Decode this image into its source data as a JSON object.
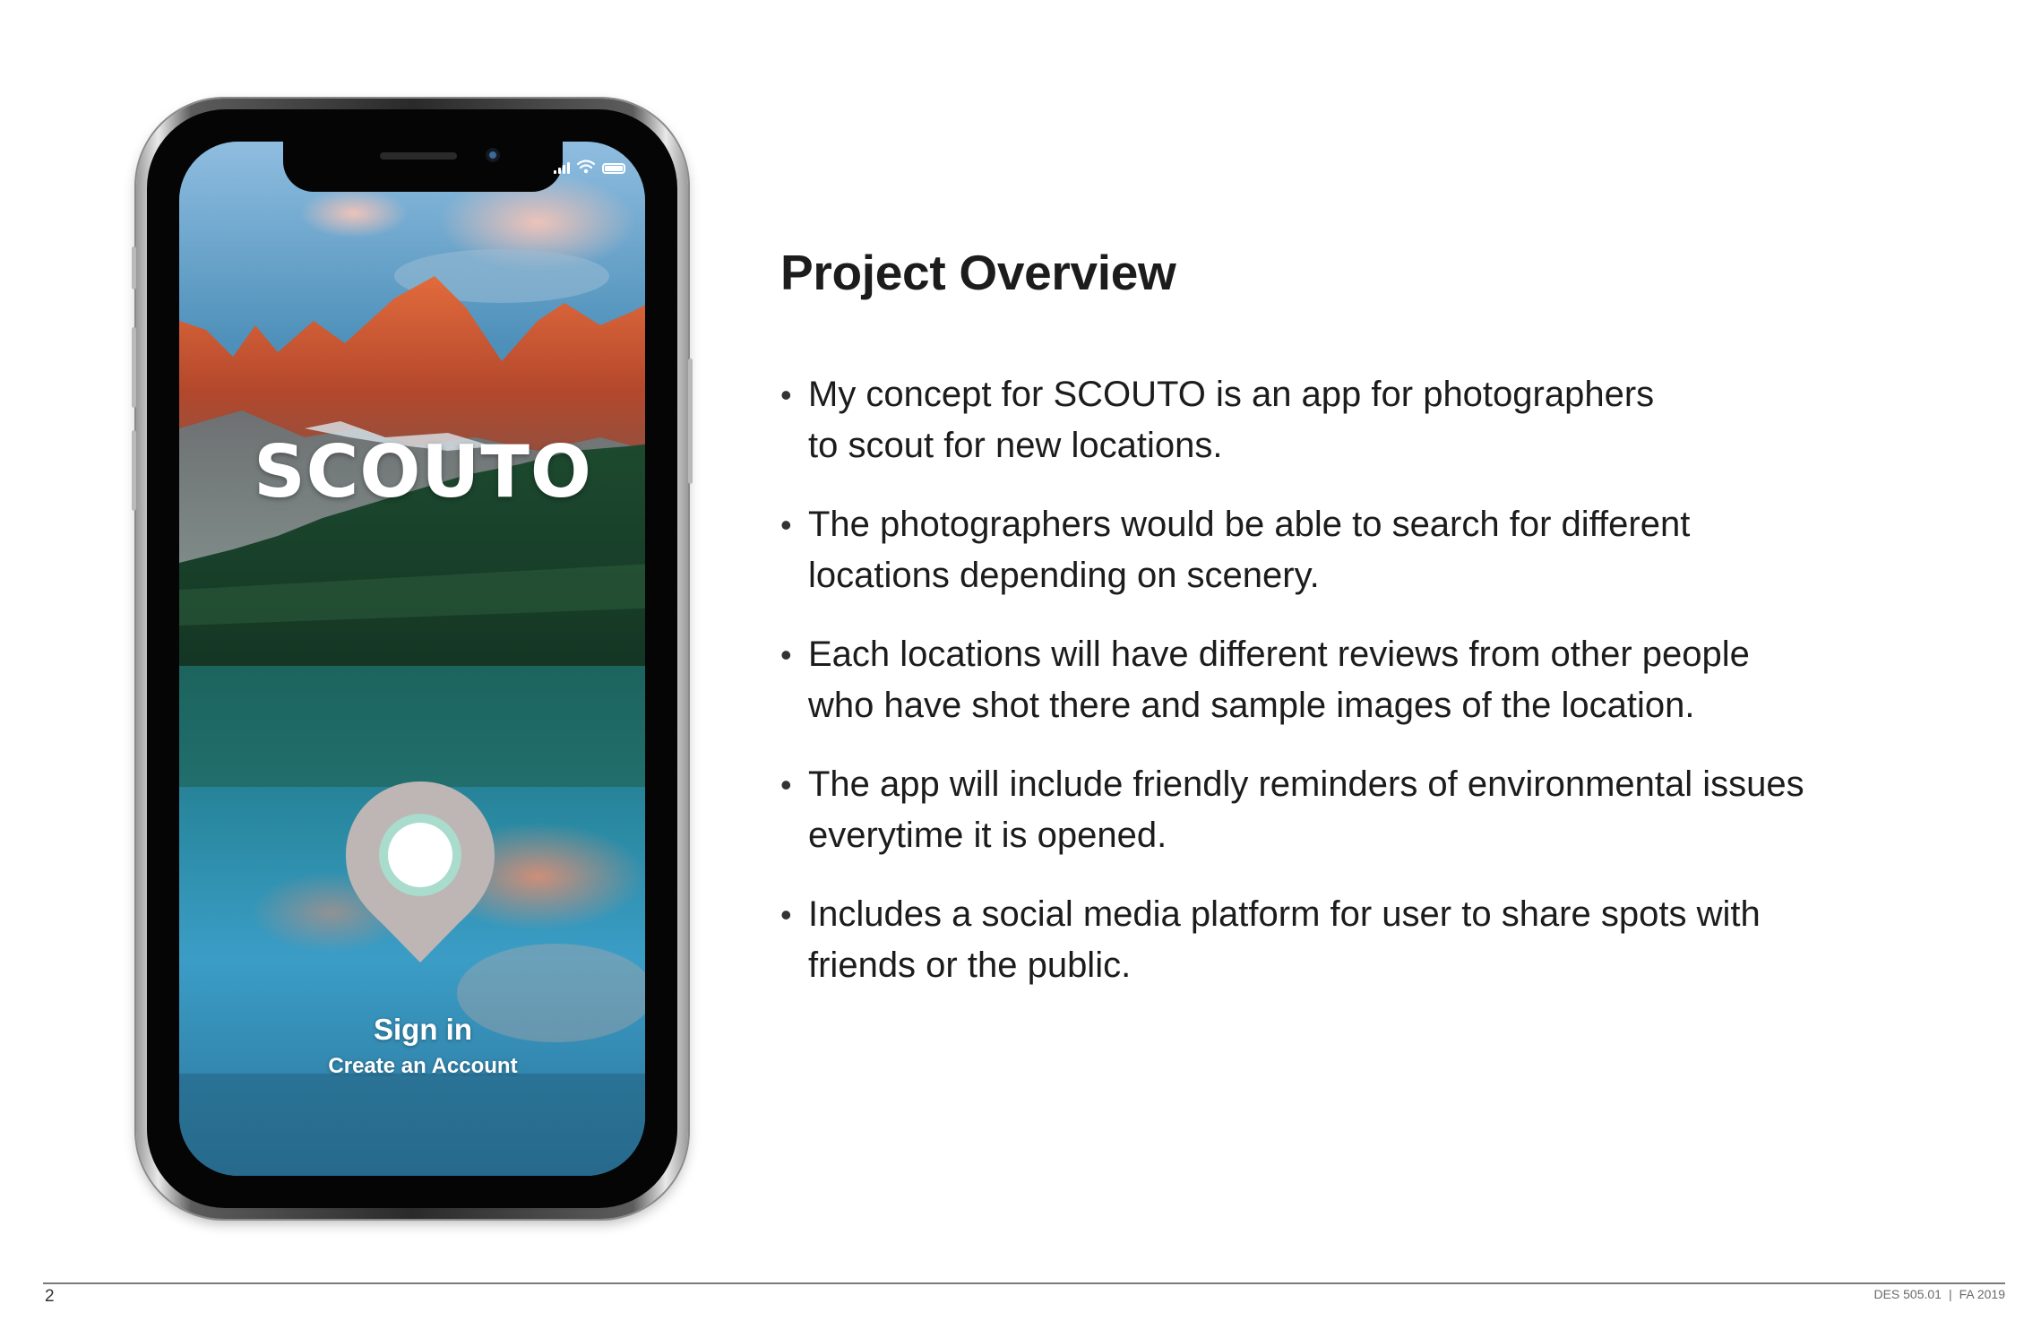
{
  "phone": {
    "app_name": "SCOUTO",
    "signin_label": "Sign in",
    "create_account_label": "Create an Account",
    "icons": [
      "signal-icon",
      "wifi-icon",
      "battery-icon",
      "location-pin-icon"
    ]
  },
  "slide": {
    "title": "Project Overview",
    "bullet_char": "•",
    "bullets": [
      {
        "line1": "My concept for SCOUTO is an app for photographers",
        "line2": "to scout for new locations."
      },
      {
        "line1": "The photographers would be able to search for different",
        "line2": "locations depending on scenery."
      },
      {
        "line1": "Each locations will have different reviews from other people",
        "line2": "who have shot there and sample images of the location."
      },
      {
        "line1": "The app will include friendly reminders of environmental issues",
        "line2": "everytime it is opened."
      },
      {
        "line1": "Includes a social media platform for user to share spots with",
        "line2": "friends or the public."
      }
    ]
  },
  "footer": {
    "page_number": "2",
    "course_code": "DES 505.01",
    "separator": "|",
    "term": "FA 2019"
  },
  "colors": {
    "text": "#1c1c1c",
    "pin": "#bdb6b4",
    "pin_ring": "#a9dccc",
    "lake": "#3a8fb6",
    "peaks": "#d8643a"
  }
}
